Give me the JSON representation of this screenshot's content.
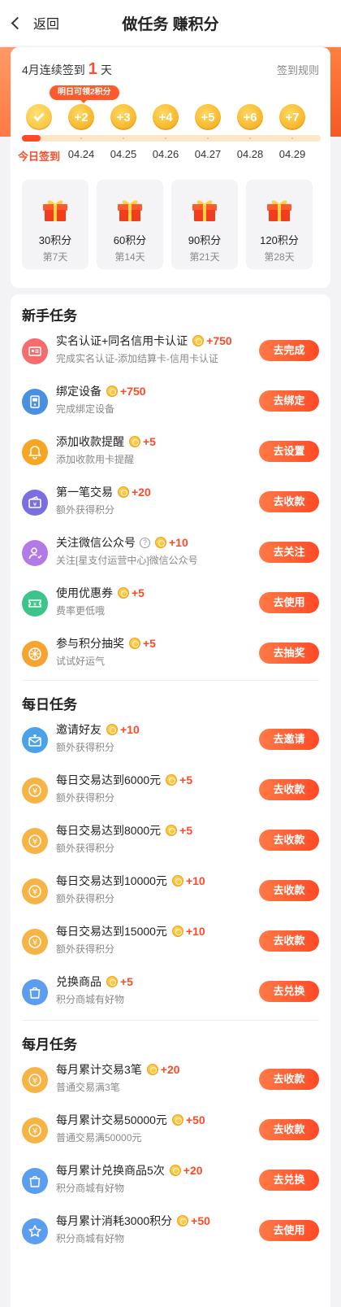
{
  "header": {
    "back_label": "返回",
    "title": "做任务 赚积分"
  },
  "signin": {
    "streak_prefix": "4月连续签到",
    "streak_count": "1",
    "streak_suffix": "天",
    "rules_label": "签到规则",
    "tomorrow_badge": "明日可领2积分",
    "coins": [
      "",
      "+2",
      "+3",
      "+4",
      "+5",
      "+6",
      "+7"
    ],
    "days": [
      "今日签到",
      "04.24",
      "04.25",
      "04.26",
      "04.27",
      "04.28",
      "04.29"
    ],
    "progress_days_done": 1,
    "progress_days_total": 7
  },
  "gifts": [
    {
      "points": "30积分",
      "day": "第7天"
    },
    {
      "points": "60积分",
      "day": "第14天"
    },
    {
      "points": "90积分",
      "day": "第21天"
    },
    {
      "points": "120积分",
      "day": "第28天"
    }
  ],
  "sections": [
    {
      "title": "新手任务",
      "tasks": [
        {
          "title": "实名认证+同名信用卡认证",
          "reward": "+750",
          "desc": "完成实名认证-添加结算卡-信用卡认证",
          "button": "去完成",
          "icon": "id-card-icon",
          "color": "#f56c6c"
        },
        {
          "title": "绑定设备",
          "reward": "+750",
          "desc": "完成绑定设备",
          "button": "去绑定",
          "icon": "device-icon",
          "color": "#4a90e2"
        },
        {
          "title": "添加收款提醒",
          "reward": "+5",
          "desc": "添加收款用卡提醒",
          "button": "去设置",
          "icon": "bell-icon",
          "color": "#f5a623"
        },
        {
          "title": "第一笔交易",
          "reward": "+20",
          "desc": "额外获得积分",
          "button": "去收款",
          "icon": "wallet-icon",
          "color": "#7b6ee0"
        },
        {
          "title": "关注微信公众号",
          "reward": "+10",
          "desc": "关注[星支付运营中心]微信公众号",
          "button": "去关注",
          "icon": "follow-icon",
          "color": "#b27ae6",
          "help": "?"
        },
        {
          "title": "使用优惠券",
          "reward": "+5",
          "desc": "费率更低哦",
          "button": "去使用",
          "icon": "coupon-icon",
          "color": "#3cc48a"
        },
        {
          "title": "参与积分抽奖",
          "reward": "+5",
          "desc": "试试好运气",
          "button": "去抽奖",
          "icon": "lottery-wheel-icon",
          "color": "#f7a330"
        }
      ]
    },
    {
      "title": "每日任务",
      "tasks": [
        {
          "title": "邀请好友",
          "reward": "+10",
          "desc": "额外获得积分",
          "button": "去邀请",
          "icon": "invite-icon",
          "color": "#4aa3e8"
        },
        {
          "title": "每日交易达到6000元",
          "reward": "+5",
          "desc": "额外获得积分",
          "button": "去收款",
          "icon": "yuan-icon",
          "color": "#f7b446"
        },
        {
          "title": "每日交易达到8000元",
          "reward": "+5",
          "desc": "额外获得积分",
          "button": "去收款",
          "icon": "yuan-icon",
          "color": "#f7b446"
        },
        {
          "title": "每日交易达到10000元",
          "reward": "+10",
          "desc": "额外获得积分",
          "button": "去收款",
          "icon": "yuan-icon",
          "color": "#f7b446"
        },
        {
          "title": "每日交易达到15000元",
          "reward": "+10",
          "desc": "额外获得积分",
          "button": "去收款",
          "icon": "yuan-icon",
          "color": "#f7b446"
        },
        {
          "title": "兑换商品",
          "reward": "+5",
          "desc": "积分商城有好物",
          "button": "去兑换",
          "icon": "shopping-bag-icon",
          "color": "#5b9ef0"
        }
      ]
    },
    {
      "title": "每月任务",
      "tasks": [
        {
          "title": "每月累计交易3笔",
          "reward": "+20",
          "desc": "普通交易满3笔",
          "button": "去收款",
          "icon": "yuan-icon",
          "color": "#f7b446"
        },
        {
          "title": "每月累计交易50000元",
          "reward": "+50",
          "desc": "普通交易满50000元",
          "button": "去收款",
          "icon": "yuan-icon",
          "color": "#f7b446"
        },
        {
          "title": "每月累计兑换商品5次",
          "reward": "+20",
          "desc": "积分商城有好物",
          "button": "去兑换",
          "icon": "shopping-bag-icon",
          "color": "#5b9ef0"
        },
        {
          "title": "每月累计消耗3000积分",
          "reward": "+50",
          "desc": "积分商城有好物",
          "button": "去使用",
          "icon": "star-icon",
          "color": "#5b9ef0"
        }
      ]
    }
  ]
}
